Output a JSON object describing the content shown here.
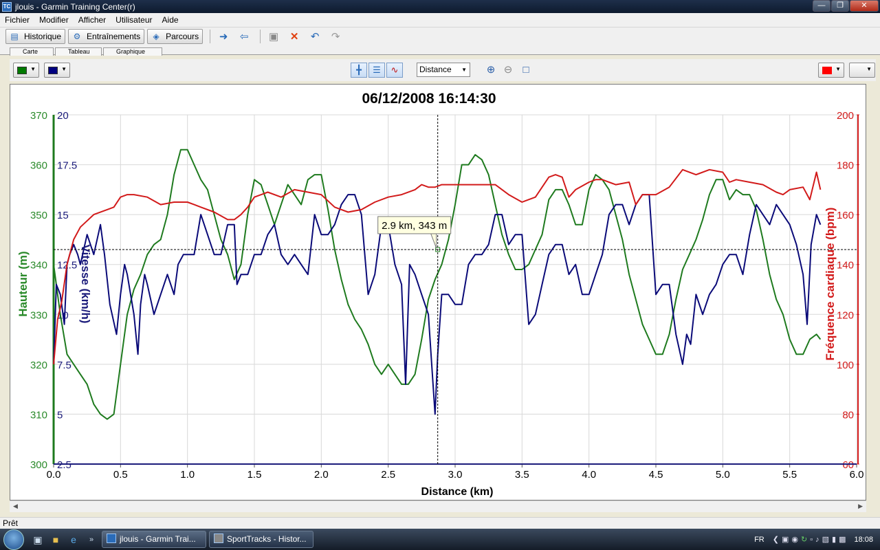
{
  "window": {
    "title": "jlouis - Garmin Training Center(r)",
    "app_icon_text": "TC"
  },
  "menu": [
    "Fichier",
    "Modifier",
    "Afficher",
    "Utilisateur",
    "Aide"
  ],
  "toolbar": {
    "historique": "Historique",
    "entrainements": "Entraînements",
    "parcours": "Parcours"
  },
  "subtabs": [
    "Carte",
    "Tableau",
    "Graphique"
  ],
  "controls": {
    "left_color_1": "#007a00",
    "left_color_2": "#000080",
    "right_color": "#ff0000",
    "x_axis_select": "Distance"
  },
  "status": {
    "text": "Prêt"
  },
  "taskbar": {
    "tasks": [
      "jlouis - Garmin Trai...",
      "SportTracks - Histor..."
    ],
    "lang": "FR",
    "clock": "18:08"
  },
  "chart_data": {
    "type": "line",
    "title": "06/12/2008 16:14:30",
    "xlabel": "Distance (km)",
    "xlim": [
      0,
      6
    ],
    "x_ticks": [
      "0.0",
      "0.5",
      "1.0",
      "1.5",
      "2.0",
      "2.5",
      "3.0",
      "3.5",
      "4.0",
      "4.5",
      "5.0",
      "5.5",
      "6.0"
    ],
    "grid": true,
    "axes": {
      "left": {
        "label": "Hauteur (m)",
        "ylim": [
          300,
          370
        ],
        "ticks": [
          "300",
          "310",
          "320",
          "330",
          "340",
          "350",
          "360",
          "370"
        ],
        "color": "#2a8a2a"
      },
      "left2": {
        "label": "Vitesse (km/h)",
        "ylim": [
          2.5,
          20
        ],
        "ticks": [
          "2.5",
          "5",
          "7.5",
          "10",
          "12.5",
          "15",
          "17.5",
          "20"
        ],
        "color": "#1a1a7a"
      },
      "right": {
        "label": "Fréquence cardiaque (bpm)",
        "ylim": [
          60,
          200
        ],
        "ticks": [
          "60",
          "80",
          "100",
          "120",
          "140",
          "160",
          "180",
          "200"
        ],
        "color": "#d21a1a"
      }
    },
    "series": [
      {
        "axis": "left",
        "color": "#1e7a1e",
        "x": [
          0,
          0.05,
          0.1,
          0.15,
          0.2,
          0.25,
          0.3,
          0.35,
          0.4,
          0.45,
          0.5,
          0.55,
          0.6,
          0.65,
          0.7,
          0.75,
          0.8,
          0.85,
          0.9,
          0.95,
          1.0,
          1.05,
          1.1,
          1.15,
          1.2,
          1.25,
          1.3,
          1.35,
          1.4,
          1.45,
          1.5,
          1.55,
          1.6,
          1.65,
          1.7,
          1.75,
          1.8,
          1.85,
          1.9,
          1.95,
          2.0,
          2.05,
          2.1,
          2.15,
          2.2,
          2.25,
          2.3,
          2.35,
          2.4,
          2.45,
          2.5,
          2.55,
          2.6,
          2.65,
          2.7,
          2.75,
          2.8,
          2.85,
          2.9,
          2.95,
          3.0,
          3.05,
          3.1,
          3.15,
          3.2,
          3.25,
          3.3,
          3.35,
          3.4,
          3.45,
          3.5,
          3.55,
          3.6,
          3.65,
          3.7,
          3.75,
          3.8,
          3.85,
          3.9,
          3.95,
          4.0,
          4.05,
          4.1,
          4.15,
          4.2,
          4.25,
          4.3,
          4.35,
          4.4,
          4.45,
          4.5,
          4.55,
          4.6,
          4.65,
          4.7,
          4.75,
          4.8,
          4.85,
          4.9,
          4.95,
          5.0,
          5.05,
          5.1,
          5.15,
          5.2,
          5.25,
          5.3,
          5.35,
          5.4,
          5.45,
          5.5,
          5.55,
          5.6,
          5.65,
          5.7,
          5.73
        ],
        "values": [
          340,
          330,
          322,
          320,
          318,
          316,
          312,
          310,
          309,
          310,
          320,
          330,
          335,
          338,
          342,
          344,
          345,
          350,
          358,
          363,
          363,
          360,
          357,
          355,
          350,
          345,
          342,
          337,
          340,
          350,
          357,
          356,
          352,
          348,
          352,
          356,
          354,
          352,
          357,
          358,
          358,
          351,
          343,
          337,
          332,
          329,
          327,
          324,
          320,
          318,
          320,
          318,
          316,
          316,
          318,
          325,
          333,
          337,
          340,
          345,
          352,
          360,
          360,
          362,
          361,
          358,
          352,
          346,
          342,
          339,
          339,
          340,
          343,
          346,
          353,
          355,
          355,
          352,
          348,
          348,
          355,
          358,
          357,
          355,
          350,
          345,
          338,
          333,
          328,
          325,
          322,
          322,
          326,
          333,
          339,
          342,
          345,
          349,
          354,
          357,
          357,
          353,
          355,
          354,
          354,
          351,
          345,
          338,
          333,
          330,
          325,
          322,
          322,
          325,
          326,
          325
        ],
        "name": ""
      },
      {
        "axis": "left2",
        "color": "#0a0a78",
        "x": [
          0,
          0.02,
          0.05,
          0.08,
          0.1,
          0.12,
          0.15,
          0.18,
          0.2,
          0.25,
          0.3,
          0.35,
          0.38,
          0.42,
          0.47,
          0.5,
          0.53,
          0.55,
          0.6,
          0.63,
          0.65,
          0.68,
          0.7,
          0.75,
          0.8,
          0.85,
          0.9,
          0.93,
          0.97,
          1.0,
          1.05,
          1.1,
          1.15,
          1.2,
          1.25,
          1.3,
          1.35,
          1.37,
          1.4,
          1.45,
          1.5,
          1.55,
          1.6,
          1.65,
          1.7,
          1.75,
          1.8,
          1.85,
          1.9,
          1.95,
          2.0,
          2.05,
          2.1,
          2.15,
          2.2,
          2.25,
          2.3,
          2.35,
          2.4,
          2.45,
          2.5,
          2.55,
          2.6,
          2.63,
          2.66,
          2.7,
          2.75,
          2.8,
          2.83,
          2.85,
          2.87,
          2.9,
          2.95,
          3.0,
          3.05,
          3.1,
          3.15,
          3.2,
          3.25,
          3.3,
          3.35,
          3.4,
          3.45,
          3.5,
          3.55,
          3.6,
          3.65,
          3.7,
          3.75,
          3.8,
          3.85,
          3.9,
          3.95,
          4.0,
          4.05,
          4.1,
          4.15,
          4.2,
          4.25,
          4.3,
          4.35,
          4.4,
          4.45,
          4.5,
          4.55,
          4.6,
          4.65,
          4.7,
          4.73,
          4.76,
          4.8,
          4.85,
          4.9,
          4.95,
          5.0,
          5.05,
          5.1,
          5.15,
          5.2,
          5.25,
          5.3,
          5.35,
          5.4,
          5.45,
          5.5,
          5.55,
          5.6,
          5.63,
          5.66,
          5.7,
          5.73
        ],
        "values": [
          7.5,
          11.5,
          11,
          9.5,
          12.5,
          13,
          13.5,
          13,
          12.5,
          14,
          13,
          14.5,
          13,
          10.5,
          9,
          11,
          12.5,
          12,
          10,
          8,
          10.5,
          12,
          11.5,
          10,
          11,
          12,
          11,
          12.5,
          13,
          13,
          13,
          15,
          14,
          13,
          13,
          14.5,
          14.5,
          11.5,
          12,
          12,
          13,
          13,
          14,
          14.5,
          13,
          12.5,
          13,
          12.5,
          12,
          15,
          14,
          14,
          14.5,
          15.5,
          16,
          16,
          15,
          11,
          12,
          14.5,
          14.5,
          12.5,
          11.5,
          6.5,
          12.5,
          12,
          11,
          10,
          7,
          5,
          8,
          11,
          11,
          10.5,
          10.5,
          12.5,
          13,
          13,
          13.5,
          15,
          15,
          13.5,
          14,
          14,
          9.5,
          10,
          11.5,
          13,
          13.5,
          13.5,
          12,
          12.5,
          11,
          11,
          12,
          13,
          15,
          15.5,
          15.5,
          14.5,
          15.5,
          16,
          16,
          11,
          11.5,
          11.5,
          9,
          7.5,
          9,
          8.5,
          11,
          10,
          11,
          11.5,
          12.5,
          13,
          13,
          12,
          14,
          15.5,
          15,
          14.5,
          15.5,
          15,
          14.5,
          13.5,
          12,
          9.5,
          13.5,
          15,
          14.5
        ],
        "name": ""
      },
      {
        "axis": "right",
        "color": "#d21a1a",
        "x": [
          0,
          0.03,
          0.06,
          0.1,
          0.15,
          0.2,
          0.3,
          0.4,
          0.45,
          0.5,
          0.55,
          0.6,
          0.7,
          0.8,
          0.9,
          1.0,
          1.05,
          1.1,
          1.2,
          1.3,
          1.35,
          1.4,
          1.45,
          1.5,
          1.6,
          1.7,
          1.8,
          1.9,
          2.0,
          2.1,
          2.2,
          2.3,
          2.4,
          2.5,
          2.6,
          2.7,
          2.75,
          2.8,
          2.85,
          2.9,
          3.0,
          3.1,
          3.2,
          3.3,
          3.4,
          3.5,
          3.6,
          3.7,
          3.75,
          3.8,
          3.85,
          3.9,
          4.0,
          4.05,
          4.1,
          4.2,
          4.3,
          4.35,
          4.4,
          4.5,
          4.6,
          4.7,
          4.8,
          4.9,
          5.0,
          5.05,
          5.1,
          5.2,
          5.3,
          5.4,
          5.45,
          5.5,
          5.6,
          5.65,
          5.7,
          5.73
        ],
        "values": [
          100,
          118,
          125,
          140,
          150,
          155,
          160,
          162,
          163,
          167,
          168,
          168,
          167,
          164,
          165,
          165,
          164,
          163,
          161,
          158,
          158,
          160,
          163,
          167,
          169,
          167,
          170,
          169,
          168,
          163,
          161,
          162,
          165,
          167,
          168,
          170,
          172,
          171,
          171,
          172,
          172,
          172,
          172,
          172,
          168,
          165,
          167,
          175,
          176,
          175,
          167,
          170,
          173,
          174,
          174,
          172,
          173,
          164,
          168,
          168,
          171,
          178,
          176,
          178,
          177,
          173,
          174,
          173,
          172,
          169,
          168,
          170,
          171,
          166,
          177,
          170
        ],
        "name": ""
      }
    ],
    "cursor": {
      "x": 2.87,
      "y": 343,
      "label": "2.9 km, 343 m"
    }
  }
}
